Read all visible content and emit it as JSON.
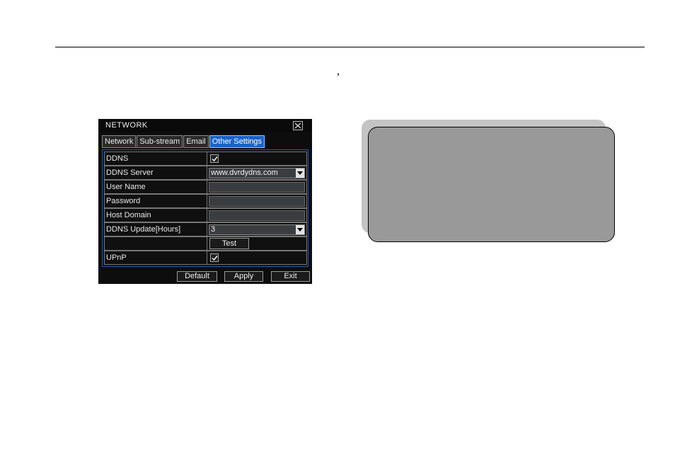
{
  "page": {
    "stray_mark": ","
  },
  "dialog": {
    "title": "NETWORK",
    "close_icon": "close-icon",
    "tabs": [
      {
        "label": "Network",
        "active": false
      },
      {
        "label": "Sub-stream",
        "active": false
      },
      {
        "label": "Email",
        "active": false
      },
      {
        "label": "Other Settings",
        "active": true
      }
    ],
    "fields": {
      "ddns": {
        "label": "DDNS",
        "checked": true
      },
      "ddns_server": {
        "label": "DDNS Server",
        "value": "www.dvrdydns.com"
      },
      "user_name": {
        "label": "User Name",
        "value": ""
      },
      "password": {
        "label": "Password",
        "value": ""
      },
      "host_domain": {
        "label": "Host Domain",
        "value": ""
      },
      "ddns_update": {
        "label": "DDNS Update[Hours]",
        "value": "3"
      },
      "test_button": "Test",
      "upnp": {
        "label": "UPnP",
        "checked": true
      }
    },
    "buttons": {
      "default": "Default",
      "apply": "Apply",
      "exit": "Exit"
    },
    "colors": {
      "background": "#0d0d0d",
      "active_tab": "#1a63c8",
      "panel_border": "#2d56a8"
    }
  },
  "note_box": {
    "text": "",
    "fill": "#999999",
    "shadow": "#c4c4c4"
  }
}
